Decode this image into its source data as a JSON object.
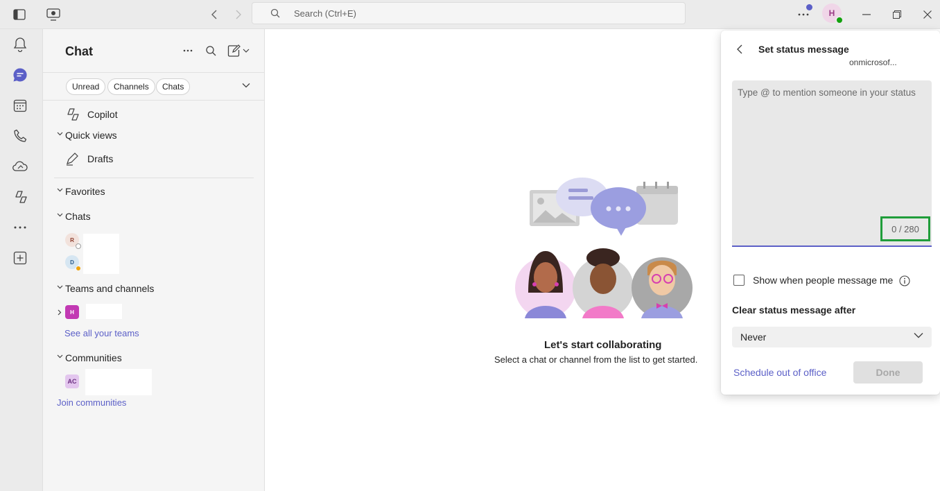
{
  "titlebar": {
    "search_placeholder": "Search (Ctrl+E)",
    "avatar_initial": "H",
    "icons": [
      "sidebar-toggle-icon",
      "device-icon",
      "back-icon",
      "forward-icon",
      "more-icon",
      "minimize-icon",
      "restore-icon",
      "close-icon"
    ]
  },
  "rail": {
    "items": [
      "bell-icon",
      "chat-icon",
      "calendar-icon",
      "calls-icon",
      "onedrive-icon",
      "copilot-icon",
      "more-apps-icon",
      "add-apps-icon"
    ],
    "accent": "#5b5fc7"
  },
  "leftpane": {
    "title": "Chat",
    "filters": [
      "Unread",
      "Channels",
      "Chats"
    ],
    "copilot": "Copilot",
    "quick_views": "Quick views",
    "drafts": "Drafts",
    "favorites": "Favorites",
    "chats": "Chats",
    "chat_avatars": [
      "R",
      "D"
    ],
    "teams_and_channels": "Teams and channels",
    "team_avatar": "H",
    "see_all_teams": "See all your teams",
    "communities": "Communities",
    "community_avatar": "AC",
    "join_communities": "Join communities"
  },
  "main": {
    "empty_title": "Let's start collaborating",
    "empty_subtitle": "Select a chat or channel from the list to get started."
  },
  "status_popover": {
    "title": "Set status message",
    "subtitle": "onmicrosof...",
    "placeholder": "Type @ to mention someone in your status",
    "counter": "0 / 280",
    "show_when_label": "Show when people message me",
    "clear_after_label": "Clear status message after",
    "clear_after_value": "Never",
    "schedule_link": "Schedule out of office",
    "done_label": "Done"
  }
}
